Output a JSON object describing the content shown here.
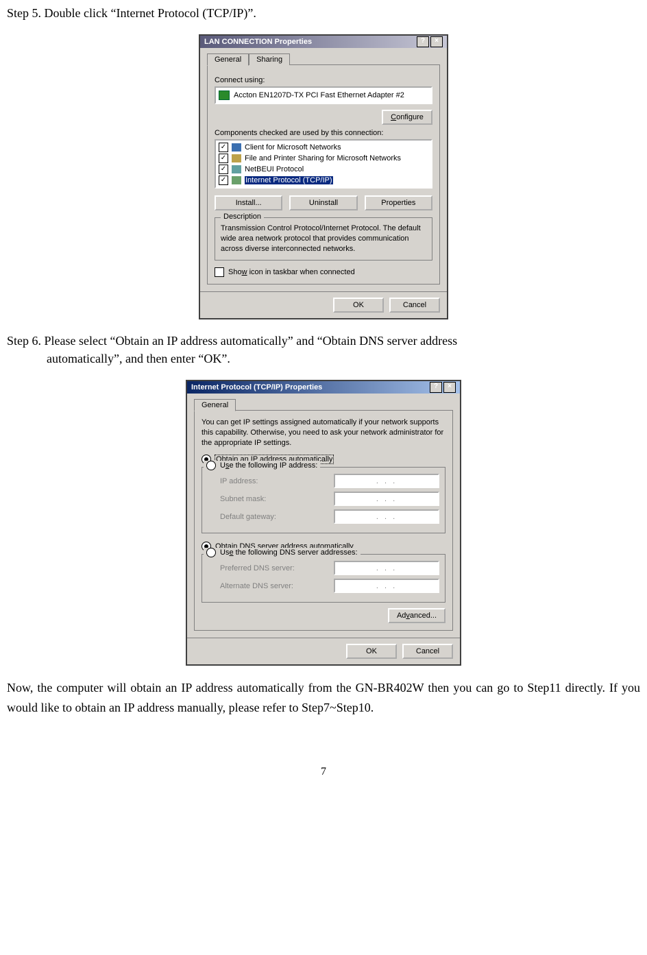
{
  "pageNumber": "7",
  "step5": "Step 5. Double click “Internet Protocol (TCP/IP)”.",
  "step6": "Step 6. Please select “Obtain an IP address automatically” and “Obtain DNS server address",
  "step6b": "automatically”, and then enter “OK”.",
  "footnote": "Now, the computer will obtain an IP address automatically from the GN-BR402W then you can go to Step11 directly. If you would like to obtain an IP address manually, please refer to Step7~Step10.",
  "dlg1": {
    "title": "LAN CONNECTION Properties",
    "tabs": {
      "general": "General",
      "sharing": "Sharing"
    },
    "connectUsing": "Connect using:",
    "adapter": "Accton EN1207D-TX PCI Fast Ethernet Adapter #2",
    "configure": "Configure",
    "componentsLabel": "Components checked are used by this connection:",
    "items": [
      "Client for Microsoft Networks",
      "File and Printer Sharing for Microsoft Networks",
      "NetBEUI Protocol",
      "Internet Protocol (TCP/IP)"
    ],
    "install": "Install...",
    "uninstall": "Uninstall",
    "properties": "Properties",
    "descTitle": "Description",
    "desc": "Transmission Control Protocol/Internet Protocol. The default wide area network protocol that provides communication across diverse interconnected networks.",
    "showIcon": "Show icon in taskbar when connected",
    "ok": "OK",
    "cancel": "Cancel"
  },
  "dlg2": {
    "title": "Internet Protocol (TCP/IP) Properties",
    "tab": "General",
    "info": "You can get IP settings assigned automatically if your network supports this capability. Otherwise, you need to ask your network administrator for the appropriate IP settings.",
    "r1": "Obtain an IP address automatically",
    "r2": "Use the following IP address:",
    "ip": "IP address:",
    "subnet": "Subnet mask:",
    "gateway": "Default gateway:",
    "r3": "Obtain DNS server address automatically",
    "r4": "Use the following DNS server addresses:",
    "pdns": "Preferred DNS server:",
    "adns": "Alternate DNS server:",
    "advanced": "Advanced...",
    "ok": "OK",
    "cancel": "Cancel",
    "dots": ".       .       ."
  }
}
